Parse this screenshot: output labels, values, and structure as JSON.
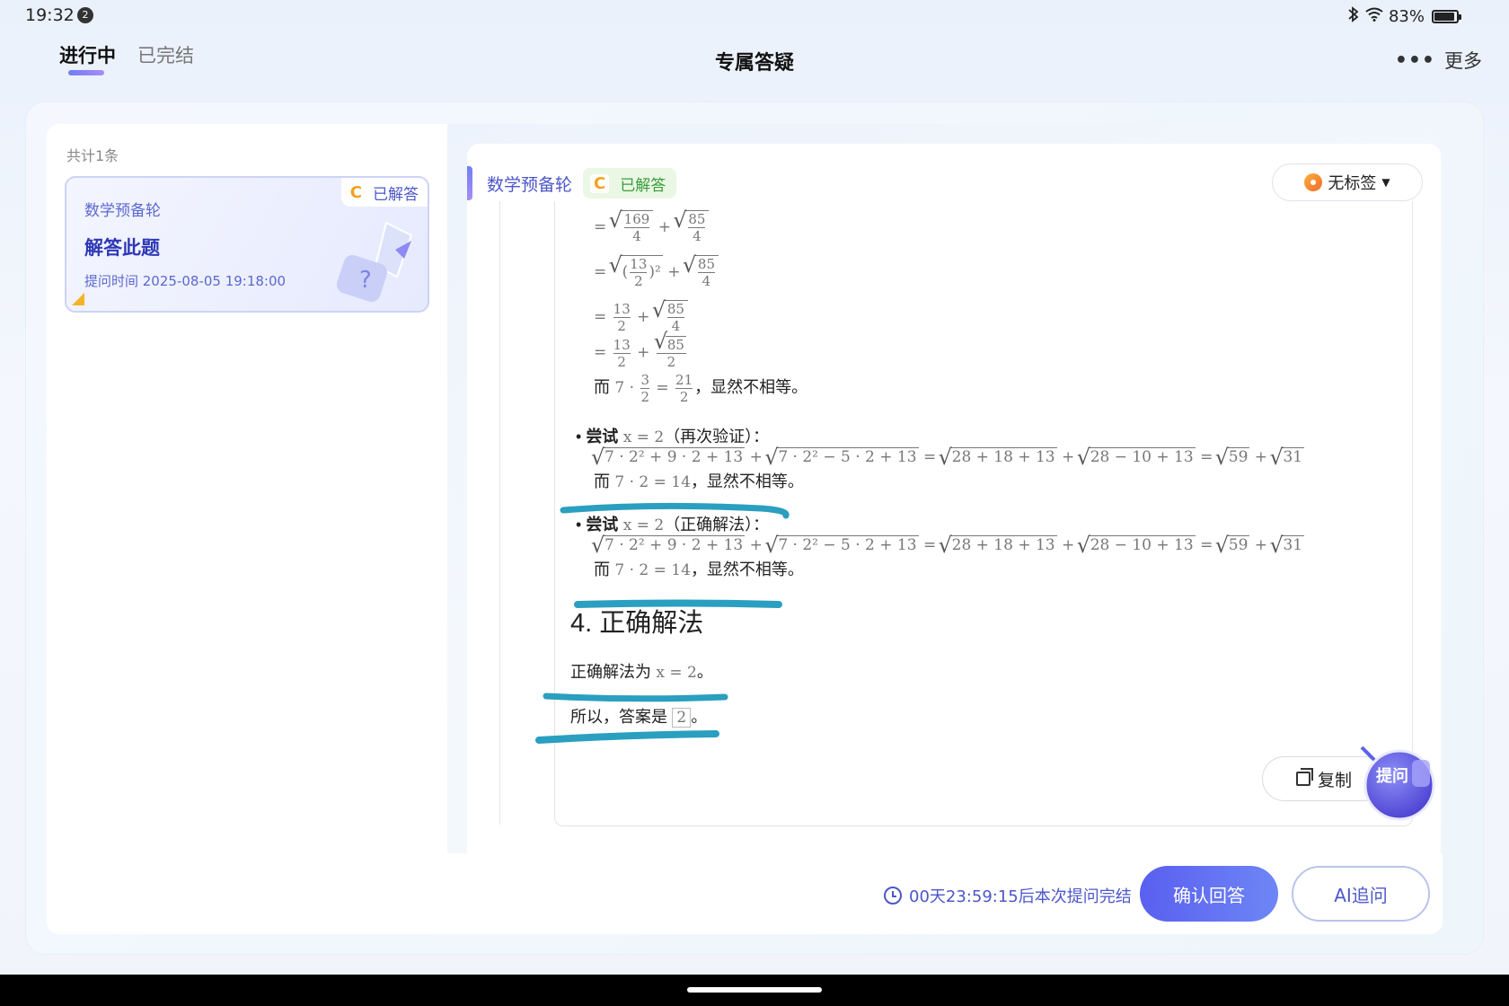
{
  "status": {
    "time": "19:32",
    "notifications": "2",
    "battery": "83%"
  },
  "tabs": [
    {
      "label": "进行中",
      "active": true
    },
    {
      "label": "已完结",
      "active": false
    }
  ],
  "page_title": "专属答疑",
  "more_label": "更多",
  "list": {
    "count": "共计1条",
    "items": [
      {
        "subject": "数学预备轮",
        "badge_letter": "C",
        "status": "已解答",
        "title": "解答此题",
        "time": "提问时间 2025-08-05 19:18:00"
      }
    ]
  },
  "answer": {
    "subject": "数学预备轮",
    "badge_letter": "C",
    "status": "已解答",
    "tag": "无标签",
    "m_frac_169_4": [
      "169",
      "4"
    ],
    "m_frac_85_4": [
      "85",
      "4"
    ],
    "m_frac_13_2": [
      "13",
      "2"
    ],
    "m_frac_3_2": [
      "3",
      "2"
    ],
    "m_frac_21_2": [
      "21",
      "2"
    ],
    "m_sqrt85": "85",
    "step_compare_text": "而",
    "not_equal": "，显然不相等。",
    "bullet1_bold": "尝试",
    "bullet1_math": "x = 2",
    "bullet1_note": "（再次验证）：",
    "bullet_expr": "7 · 2² + 9 · 2 + 13",
    "bullet_expr2": "7 · 2² − 5 · 2 + 13",
    "bullet_expr3": "28 + 18 + 13",
    "bullet_expr4": "28 − 10 + 13",
    "bullet_expr5": "59",
    "bullet_expr6": "31",
    "compare_math": "7 · 2 = 14",
    "bullet2_bold": "尝试",
    "bullet2_math": "x = 2",
    "bullet2_note": "（正确解法）：",
    "section_heading": "4. 正确解法",
    "correct_prefix": "正确解法为",
    "correct_math": "x = 2",
    "period": "。",
    "conclusion_prefix": "所以，答案是",
    "conclusion_box": "2",
    "copy_label": "复制",
    "ask_label": "提问"
  },
  "footer": {
    "countdown": "00天23:59:15后本次提问完结",
    "confirm": "确认回答",
    "ai_follow": "AI追问"
  },
  "colors": {
    "accent": "#5a5ff0",
    "pen_marks": "#2a9fc0",
    "badge_green": "#3a9d3a",
    "badge_c": "#f4a21a"
  }
}
